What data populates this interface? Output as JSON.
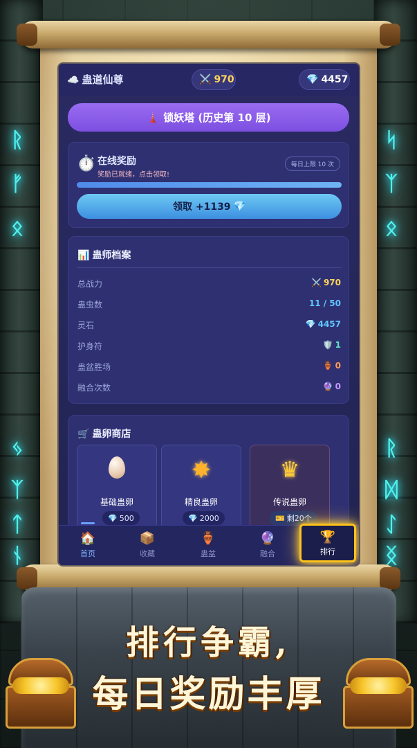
{
  "header": {
    "title_icon": "☁️",
    "title": "蛊道仙尊",
    "power_icon": "⚔️",
    "power": "970",
    "gem_icon": "💎",
    "gems": "4457"
  },
  "tower_button": {
    "icon": "🗼",
    "label": "锁妖塔 (历史第 10 层)"
  },
  "online_reward": {
    "icon": "⏱️",
    "title": "在线奖励",
    "subtitle": "奖励已就绪，点击领取!",
    "limit": "每日上限 10 次",
    "progress": 1.0,
    "claim_label": "领取 +1139",
    "claim_icon": "💎"
  },
  "profile": {
    "icon": "📊",
    "title": "蛊师档案",
    "rows": [
      {
        "label": "总战力",
        "icon": "⚔️",
        "value": "970",
        "color": "#ffd45a"
      },
      {
        "label": "蛊虫数",
        "icon": "",
        "value": "11 / 50",
        "color": "#5fc7ff"
      },
      {
        "label": "灵石",
        "icon": "💎",
        "value": "4457",
        "color": "#5fc7ff"
      },
      {
        "label": "护身符",
        "icon": "🛡️",
        "value": "1",
        "color": "#5fe0c6"
      },
      {
        "label": "蛊盆胜场",
        "icon": "🏺",
        "value": "0",
        "color": "#ff9b5c"
      },
      {
        "label": "融合次数",
        "icon": "🔮",
        "value": "0",
        "color": "#c09bff"
      }
    ]
  },
  "shop": {
    "icon": "🛒",
    "title": "蛊卵商店",
    "items": [
      {
        "name": "基础蛊卵",
        "price_icon": "💎",
        "price": "500",
        "pic": "egg"
      },
      {
        "name": "精良蛊卵",
        "price_icon": "💎",
        "price": "2000",
        "pic": "star"
      },
      {
        "name": "传说蛊卵",
        "price_icon": "🎫",
        "price": "剩20个",
        "pic": "crown"
      }
    ]
  },
  "nav": [
    {
      "icon": "🏠",
      "label": "首页",
      "active": true
    },
    {
      "icon": "📦",
      "label": "收藏",
      "active": false
    },
    {
      "icon": "🏺",
      "label": "蛊盆",
      "active": false
    },
    {
      "icon": "🔮",
      "label": "融合",
      "active": false
    },
    {
      "icon": "🏆",
      "label": "排行",
      "active": false
    }
  ],
  "banner": {
    "line1": "排行争霸,",
    "line2": "每日奖励丰厚"
  },
  "runes": {
    "left": [
      "ᚱ",
      "ᚠ",
      "ᛟ",
      "ᛃ",
      "ᛉ",
      "ᛏ",
      "ᚾ"
    ],
    "right": [
      "ᛋ",
      "ᛉ",
      "ᛟ",
      "ᚱ",
      "ᛞ",
      "ᛇ",
      "ᛝ"
    ]
  },
  "colors": {
    "accent": "#7c4fe0",
    "claim": "#3d8fe0",
    "highlight": "#ffc21a"
  }
}
